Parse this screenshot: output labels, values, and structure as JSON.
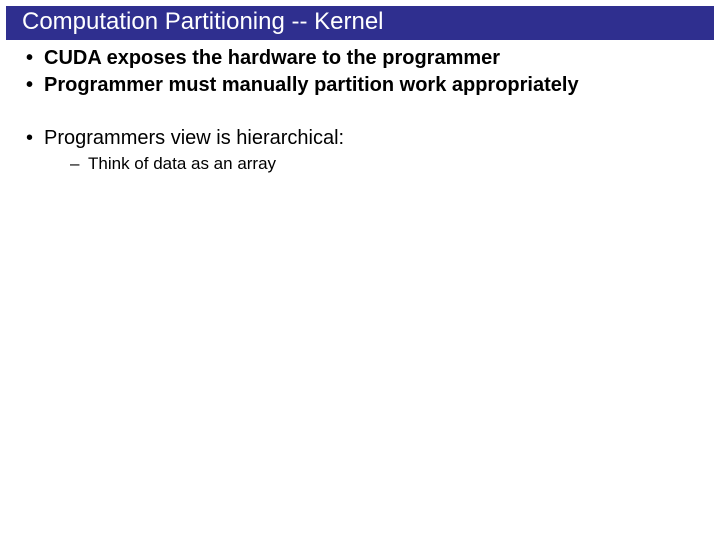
{
  "title": "Computation Partitioning -- Kernel",
  "bullets": {
    "b1": "CUDA exposes the hardware to the programmer",
    "b2": "Programmer must manually partition work appropriately",
    "b3": "Programmers view is hierarchical:",
    "b3_sub1": "Think of data as an array"
  }
}
